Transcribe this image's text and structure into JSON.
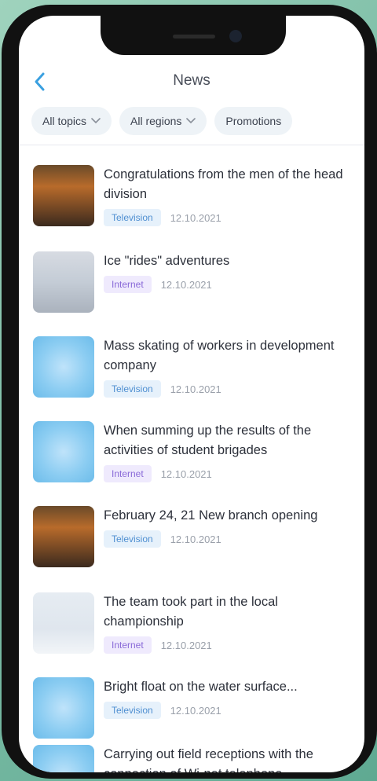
{
  "header": {
    "title": "News"
  },
  "filters": [
    {
      "label": "All topics",
      "has_dropdown": true
    },
    {
      "label": "All regions",
      "has_dropdown": true
    },
    {
      "label": "Promotions",
      "has_dropdown": false
    }
  ],
  "news": [
    {
      "title": "Congratulations from the men of the head division",
      "tag": "Television",
      "date": "12.10.2021",
      "thumb": "photo-a"
    },
    {
      "title": "Ice \"rides\" adventures",
      "tag": "Internet",
      "date": "12.10.2021",
      "thumb": "photo-b"
    },
    {
      "title": "Mass skating of workers in development company",
      "tag": "Television",
      "date": "12.10.2021",
      "thumb": "blue"
    },
    {
      "title": "When summing up the results of the activities of student brigades",
      "tag": "Internet",
      "date": "12.10.2021",
      "thumb": "blue"
    },
    {
      "title": "February 24, 21 New branch opening",
      "tag": "Television",
      "date": "12.10.2021",
      "thumb": "photo-a"
    },
    {
      "title": "The team  took part in the local championship",
      "tag": "Internet",
      "date": "12.10.2021",
      "thumb": "photo-c"
    },
    {
      "title": "Bright float on the water surface...",
      "tag": "Television",
      "date": "12.10.2021",
      "thumb": "blue"
    },
    {
      "title": "Carrying out field receptions with the connection of Wi-net telephone",
      "tag": "",
      "date": "",
      "thumb": "blue"
    }
  ],
  "colors": {
    "accent": "#3aa0e0",
    "tag_tv": "#4f8fd1",
    "tag_internet": "#8a6ad8"
  }
}
